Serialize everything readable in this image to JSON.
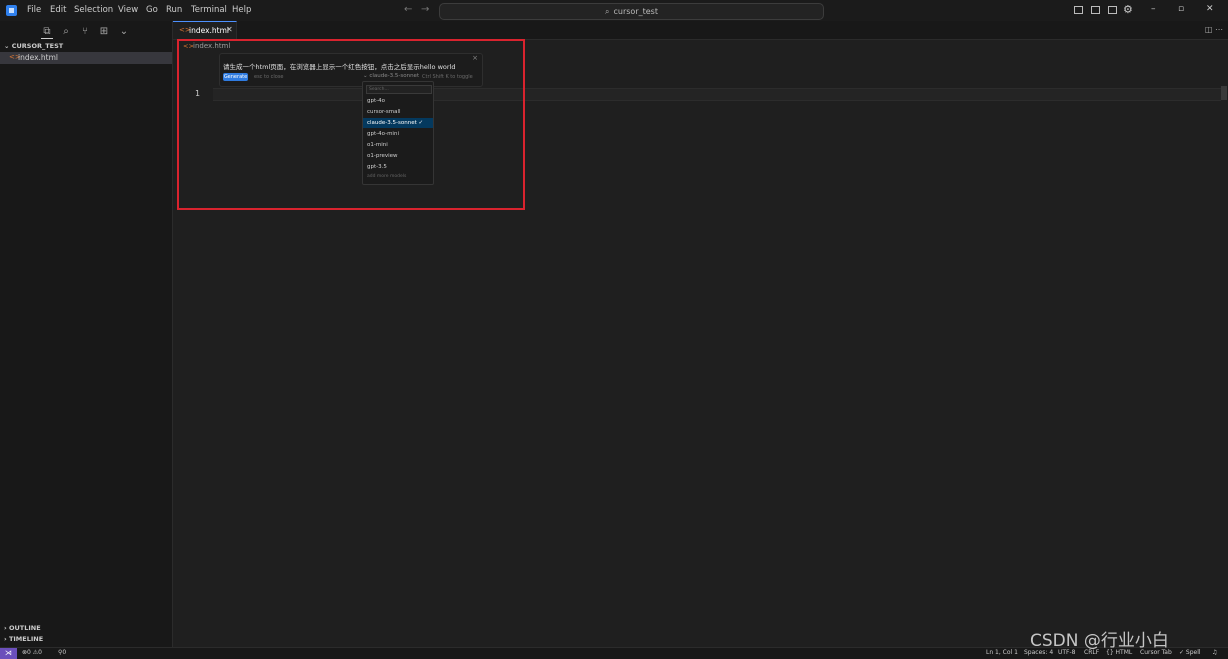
{
  "menu": [
    "File",
    "Edit",
    "Selection",
    "View",
    "Go",
    "Run",
    "Terminal",
    "Help"
  ],
  "command_center": {
    "label": "cursor_test"
  },
  "sidebar": {
    "section_title": "CURSOR_TEST",
    "files": [
      {
        "label": "index.html",
        "icon": "html-file-icon"
      }
    ],
    "bottom_sections": [
      "OUTLINE",
      "TIMELINE"
    ]
  },
  "tabs": [
    {
      "label": "index.html",
      "active": true
    }
  ],
  "editor": {
    "breadcrumb": "index.html",
    "line_number": "1",
    "prompt": {
      "text": "请生成一个html页面，在浏览器上显示一个红色按钮，点击之后显示hello world",
      "generate_label": "Generate",
      "esc_hint": "esc to close",
      "model_selected": "claude-3.5-sonnet",
      "toggle_hint": "Ctrl Shift K to toggle",
      "close": "×"
    },
    "model_menu": {
      "search_placeholder": "Search...",
      "models": [
        "gpt-4o",
        "cursor-small",
        "claude-3.5-sonnet",
        "gpt-4o-mini",
        "o1-mini",
        "o1-preview",
        "gpt-3.5"
      ],
      "selected_index": 2,
      "footer": "add more models"
    }
  },
  "statusbar": {
    "errors": "0",
    "warnings": "0",
    "ports": "0",
    "right": [
      "Ln 1, Col 1",
      "Spaces: 4",
      "UTF-8",
      "CRLF",
      "{} HTML",
      "Cursor Tab",
      "✓ Spell"
    ]
  },
  "watermark": "CSDN @行业小白",
  "colors": {
    "highlight": "#d9232e",
    "accent": "#2f7be0",
    "remote": "#6b4fbb"
  }
}
